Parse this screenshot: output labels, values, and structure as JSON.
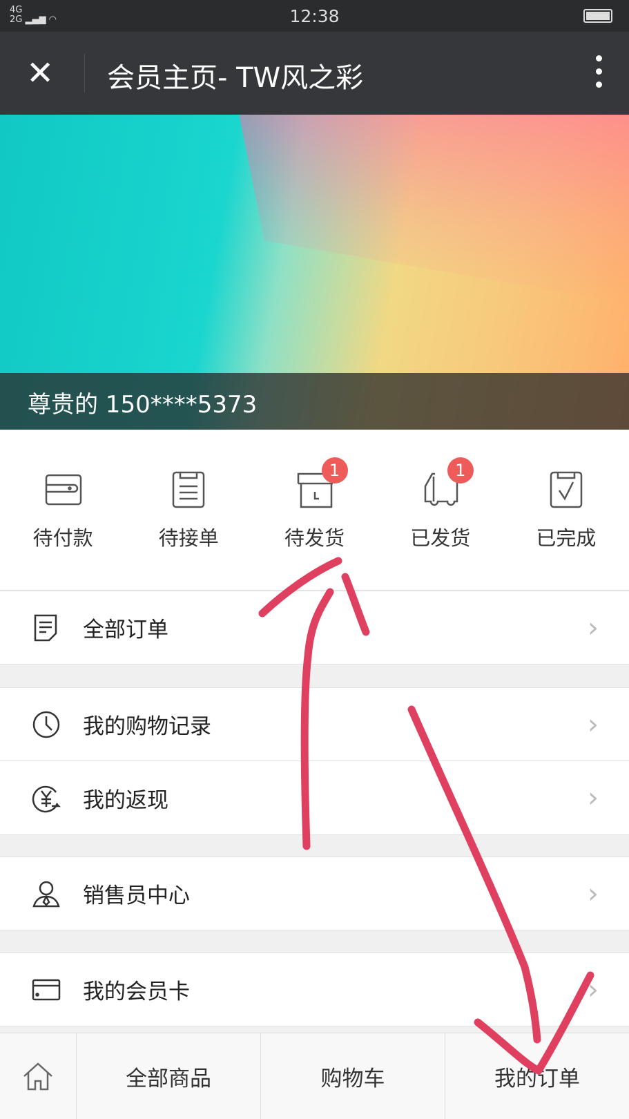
{
  "status_bar": {
    "signal": "4G 2G",
    "time": "12:38"
  },
  "nav": {
    "close_icon": "close-icon",
    "title": "会员主页- TW风之彩",
    "more_icon": "more-vertical-icon"
  },
  "banner": {
    "user_label": "尊贵的 150****5373"
  },
  "orders": [
    {
      "label": "待付款",
      "icon": "wallet-icon",
      "badge": null
    },
    {
      "label": "待接单",
      "icon": "clipboard-list-icon",
      "badge": null
    },
    {
      "label": "待发货",
      "icon": "box-clock-icon",
      "badge": "1"
    },
    {
      "label": "已发货",
      "icon": "truck-icon",
      "badge": "1"
    },
    {
      "label": "已完成",
      "icon": "clipboard-check-icon",
      "badge": null
    }
  ],
  "menu": [
    {
      "label": "全部订单",
      "icon": "document-icon"
    },
    {
      "label": "我的购物记录",
      "icon": "clock-icon"
    },
    {
      "label": "我的返现",
      "icon": "yuan-cashback-icon"
    },
    {
      "label": "销售员中心",
      "icon": "salesperson-icon"
    },
    {
      "label": "我的会员卡",
      "icon": "vip-card-icon"
    }
  ],
  "bottom_nav": {
    "home_icon": "home-icon",
    "all_products": "全部商品",
    "cart": "购物车",
    "my_orders": "我的订单"
  },
  "colors": {
    "badge": "#ee5b5b",
    "annotation": "#e0405f",
    "nav_bg": "#35373a"
  }
}
